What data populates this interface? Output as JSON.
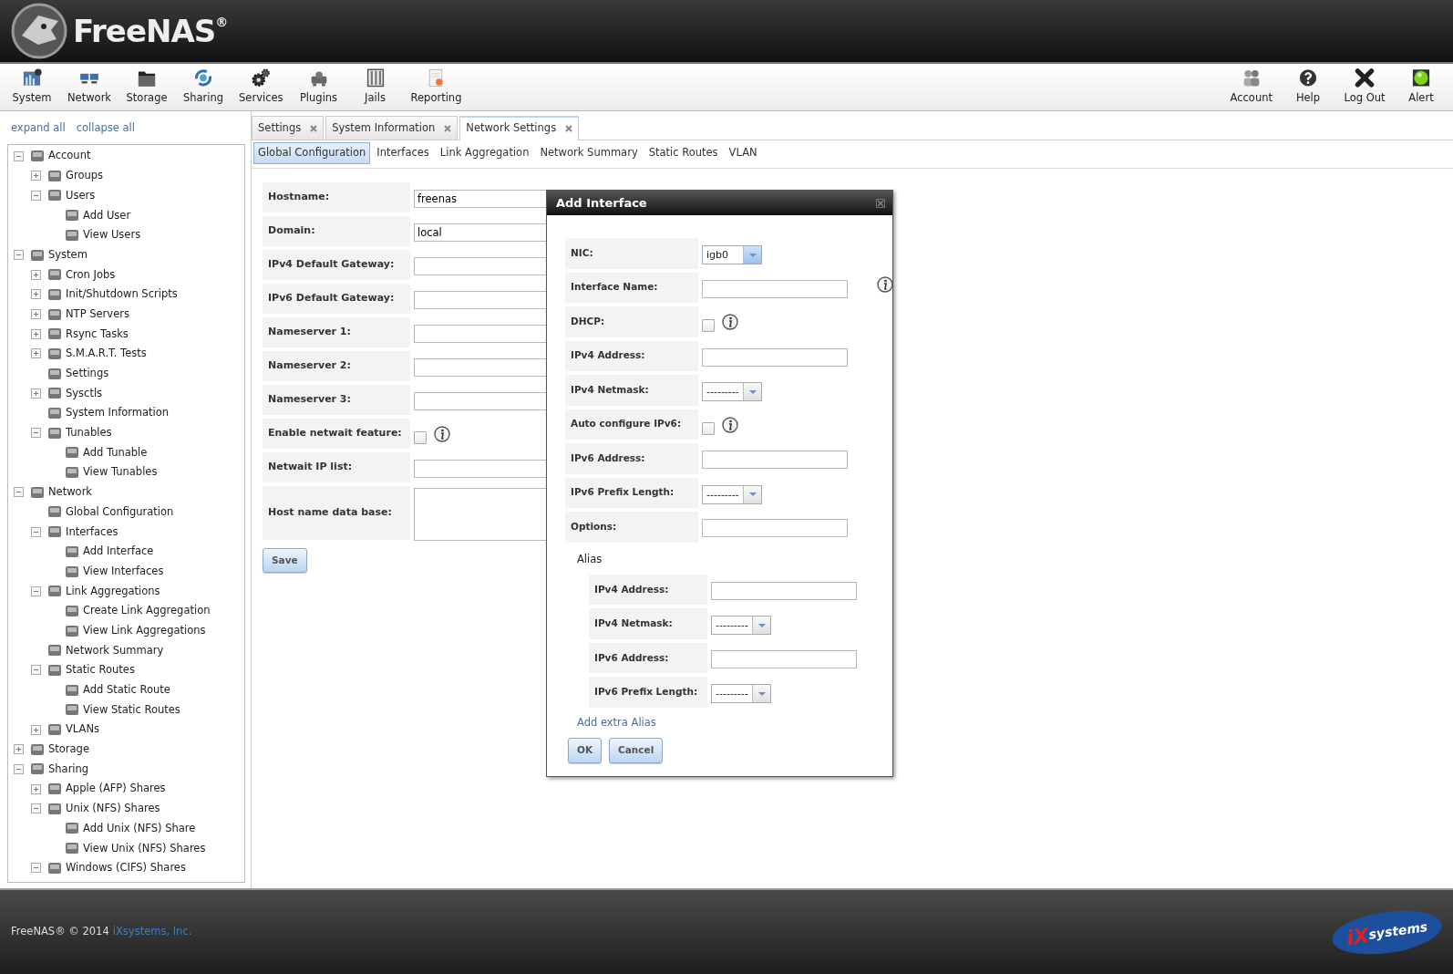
{
  "header": {
    "logo": "FreeNAS$^{®}$"
  },
  "toolbar": {
    "left": [
      {
        "label": "System"
      },
      {
        "label": "Network"
      },
      {
        "label": "Storage"
      },
      {
        "label": "Sharing"
      },
      {
        "label": "Services"
      },
      {
        "label": "Plugins"
      },
      {
        "label": "Jails"
      },
      {
        "label": "Reporting"
      }
    ],
    "right": [
      {
        "label": "Account"
      },
      {
        "label": "Help"
      },
      {
        "label": "Log Out"
      },
      {
        "label": "Alert"
      }
    ]
  },
  "sidebar": {
    "links": [
      "expand all",
      "collapse all"
    ],
    "tree": [
      {
        "label": "Account",
        "kind": "node",
        "expanded": true,
        "children": [
          {
            "label": "Groups",
            "kind": "node",
            "expanded": false
          },
          {
            "label": "Users",
            "kind": "node",
            "expanded": true,
            "children": [
              {
                "label": "Add User",
                "kind": "leaf"
              },
              {
                "label": "View Users",
                "kind": "leaf"
              }
            ]
          }
        ]
      },
      {
        "label": "System",
        "kind": "node",
        "expanded": true,
        "children": [
          {
            "label": "Cron Jobs",
            "kind": "node",
            "expanded": false
          },
          {
            "label": "Init/Shutdown Scripts",
            "kind": "node",
            "expanded": false
          },
          {
            "label": "NTP Servers",
            "kind": "node",
            "expanded": false
          },
          {
            "label": "Rsync Tasks",
            "kind": "node",
            "expanded": false
          },
          {
            "label": "S.M.A.R.T. Tests",
            "kind": "node",
            "expanded": false
          },
          {
            "label": "Settings",
            "kind": "leaf"
          },
          {
            "label": "Sysctls",
            "kind": "node",
            "expanded": false
          },
          {
            "label": "System Information",
            "kind": "leaf"
          },
          {
            "label": "Tunables",
            "kind": "node",
            "expanded": true,
            "children": [
              {
                "label": "Add Tunable",
                "kind": "leaf"
              },
              {
                "label": "View Tunables",
                "kind": "leaf"
              }
            ]
          }
        ]
      },
      {
        "label": "Network",
        "kind": "node",
        "expanded": true,
        "children": [
          {
            "label": "Global Configuration",
            "kind": "leaf"
          },
          {
            "label": "Interfaces",
            "kind": "node",
            "expanded": true,
            "children": [
              {
                "label": "Add Interface",
                "kind": "leaf"
              },
              {
                "label": "View Interfaces",
                "kind": "leaf"
              }
            ]
          },
          {
            "label": "Link Aggregations",
            "kind": "node",
            "expanded": true,
            "children": [
              {
                "label": "Create Link Aggregation",
                "kind": "leaf"
              },
              {
                "label": "View Link Aggregations",
                "kind": "leaf"
              }
            ]
          },
          {
            "label": "Network Summary",
            "kind": "leaf"
          },
          {
            "label": "Static Routes",
            "kind": "node",
            "expanded": true,
            "children": [
              {
                "label": "Add Static Route",
                "kind": "leaf"
              },
              {
                "label": "View Static Routes",
                "kind": "leaf"
              }
            ]
          },
          {
            "label": "VLANs",
            "kind": "node",
            "expanded": false
          }
        ]
      },
      {
        "label": "Storage",
        "kind": "node",
        "expanded": false
      },
      {
        "label": "Sharing",
        "kind": "node",
        "expanded": true,
        "children": [
          {
            "label": "Apple (AFP) Shares",
            "kind": "node",
            "expanded": false
          },
          {
            "label": "Unix (NFS) Shares",
            "kind": "node",
            "expanded": true,
            "children": [
              {
                "label": "Add Unix (NFS) Share",
                "kind": "leaf"
              },
              {
                "label": "View Unix (NFS) Shares",
                "kind": "leaf"
              }
            ]
          },
          {
            "label": "Windows (CIFS) Shares",
            "kind": "node",
            "expanded": true
          }
        ]
      }
    ]
  },
  "tabs": [
    {
      "label": "Settings",
      "selected": false
    },
    {
      "label": "System Information",
      "selected": false
    },
    {
      "label": "Network Settings",
      "selected": true
    }
  ],
  "subtabs": [
    {
      "label": "Global Configuration",
      "selected": true
    },
    {
      "label": "Interfaces",
      "selected": false
    },
    {
      "label": "Link Aggregation",
      "selected": false
    },
    {
      "label": "Network Summary",
      "selected": false
    },
    {
      "label": "Static Routes",
      "selected": false
    },
    {
      "label": "VLAN",
      "selected": false
    }
  ],
  "form": {
    "fields": [
      {
        "kind": "text",
        "label": "Hostname:",
        "value": "freenas"
      },
      {
        "kind": "text",
        "label": "Domain:",
        "value": "local"
      },
      {
        "kind": "text",
        "label": "IPv4 Default Gateway:"
      },
      {
        "kind": "text",
        "label": "IPv6 Default Gateway:"
      },
      {
        "kind": "text",
        "label": "Nameserver 1:"
      },
      {
        "kind": "text",
        "label": "Nameserver 2:"
      },
      {
        "kind": "text",
        "label": "Nameserver 3:"
      },
      {
        "kind": "checkbox",
        "label": "Enable netwait feature:",
        "checked": false,
        "help": true
      },
      {
        "kind": "text",
        "label": "Netwait IP list:"
      },
      {
        "kind": "textarea",
        "label": "Host name data base:"
      }
    ],
    "button": "Save"
  },
  "dialog": {
    "title": "Add Interface",
    "fields": [
      {
        "kind": "select",
        "label": "NIC:",
        "value": "igb0"
      },
      {
        "kind": "text",
        "label": "Interface Name:",
        "help": true
      },
      {
        "kind": "checkbox",
        "label": "DHCP:",
        "checked": false,
        "help": true
      },
      {
        "kind": "text",
        "label": "IPv4 Address:"
      },
      {
        "kind": "select",
        "label": "IPv4 Netmask:",
        "value": "---------"
      },
      {
        "kind": "checkbox",
        "label": "Auto configure IPv6:",
        "checked": false,
        "help": true
      },
      {
        "kind": "text",
        "label": "IPv6 Address:"
      },
      {
        "kind": "select",
        "label": "IPv6 Prefix Length:",
        "value": "---------"
      },
      {
        "kind": "text",
        "label": "Options:"
      }
    ],
    "alias": {
      "title": "Alias",
      "fields": [
        {
          "kind": "text",
          "label": "IPv4 Address:"
        },
        {
          "kind": "select",
          "label": "IPv4 Netmask:",
          "value": "---------"
        },
        {
          "kind": "text",
          "label": "IPv6 Address:"
        },
        {
          "kind": "select",
          "label": "IPv6 Prefix Length:",
          "value": "---------"
        }
      ]
    },
    "add_link": "Add extra Alias",
    "buttons": [
      "OK",
      "Cancel"
    ]
  },
  "footer": {
    "text": "FreeNAS® © 2014",
    "link": "iXsystems, Inc.",
    "logo_mark": "iX",
    "logo_text": "systems"
  }
}
